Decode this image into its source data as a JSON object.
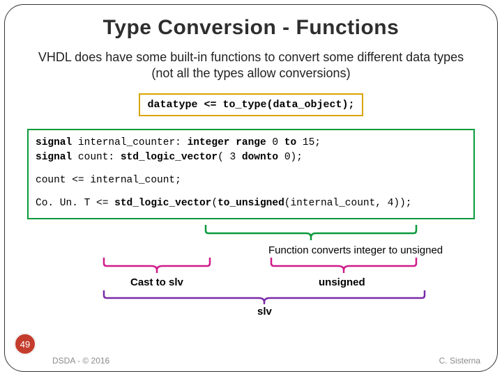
{
  "title": "Type Conversion - Functions",
  "intro": "VHDL does have some built-in functions to convert some different data types (not all the types allow conversions)",
  "syntax": "datatype <= to_type(data_object);",
  "code": {
    "l1a": "signal ",
    "l1b": "internal_counter: ",
    "l1c": "integer range ",
    "l1d": "0 ",
    "l1e": "to ",
    "l1f": "15;",
    "l2a": "signal ",
    "l2b": "count: ",
    "l2c": "std_logic_vector",
    "l2d": "( 3 ",
    "l2e": "downto ",
    "l2f": "0);",
    "l3": "count <= internal_count;",
    "l4a": "Co. Un. T <= ",
    "l4b": "std_logic_vector",
    "l4c": "(",
    "l4d": "to_unsigned",
    "l4e": "(internal_count, 4));"
  },
  "annot": {
    "func_label": "Function converts integer to unsigned",
    "cast_label": "Cast to slv",
    "unsigned_label": "unsigned",
    "slv_label": "slv"
  },
  "page": "49",
  "footer_left": "DSDA - © 2016",
  "footer_right": "C. Sisterna"
}
